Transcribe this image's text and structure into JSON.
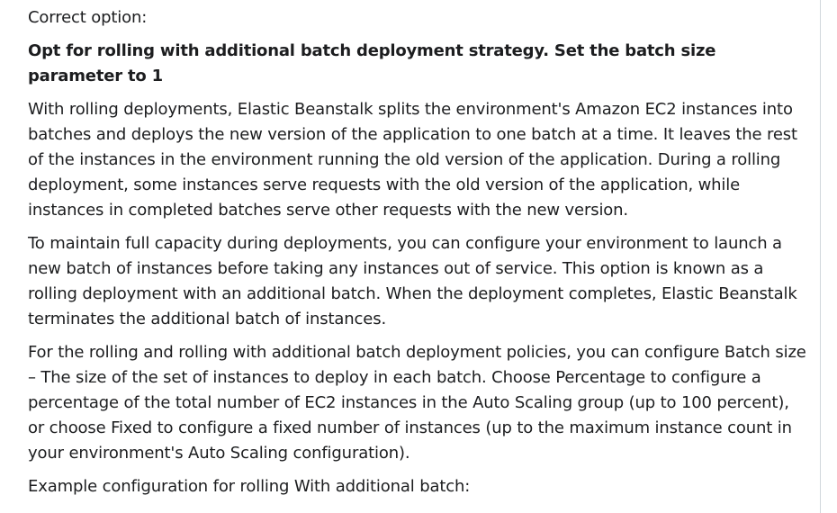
{
  "explanation": {
    "label": "Correct option:",
    "answer": "Opt for rolling with additional batch deployment strategy. Set the batch size parameter to 1",
    "paragraphs": [
      "With rolling deployments, Elastic Beanstalk splits the environment's Amazon EC2 instances into batches and deploys the new version of the application to one batch at a time. It leaves the rest of the instances in the environment running the old version of the application. During a rolling deployment, some instances serve requests with the old version of the application, while instances in completed batches serve other requests with the new version.",
      "To maintain full capacity during deployments, you can configure your environment to launch a new batch of instances before taking any instances out of service. This option is known as a rolling deployment with an additional batch. When the deployment completes, Elastic Beanstalk terminates the additional batch of instances.",
      "For the rolling and rolling with additional batch deployment policies, you can configure Batch size – The size of the set of instances to deploy in each batch. Choose Percentage to configure a percentage of the total number of EC2 instances in the Auto Scaling group (up to 100 percent), or choose Fixed to configure a fixed number of instances (up to the maximum instance count in your environment's Auto Scaling configuration).",
      "Example configuration for rolling With additional batch:"
    ]
  }
}
